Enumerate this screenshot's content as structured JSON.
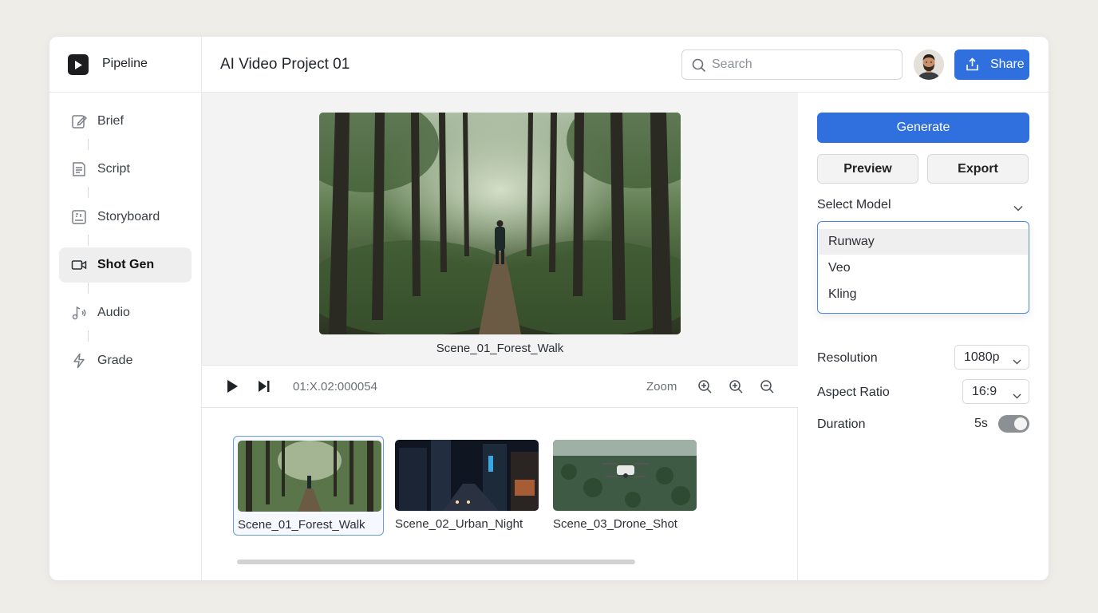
{
  "brand": {
    "name": "Pipeline",
    "logo_icon": "play-icon"
  },
  "sidebar": {
    "items": [
      {
        "label": "Brief",
        "icon": "edit-icon"
      },
      {
        "label": "Script",
        "icon": "document-icon"
      },
      {
        "label": "Storyboard",
        "icon": "storyboard-icon"
      },
      {
        "label": "Shot Gen",
        "icon": "video-camera-icon",
        "active": true
      },
      {
        "label": "Audio",
        "icon": "music-note-icon"
      },
      {
        "label": "Grade",
        "icon": "lightning-icon"
      }
    ]
  },
  "header": {
    "title": "AI Video Project 01",
    "search_placeholder": "Search",
    "share_label": "Share"
  },
  "preview": {
    "caption": "Scene_01_Forest_Walk"
  },
  "controls": {
    "timecode": "01:X.02:000054",
    "zoom_label": "Zoom"
  },
  "scenes": [
    {
      "name": "Scene_01_Forest_Walk",
      "selected": true
    },
    {
      "name": "Scene_02_Urban_Night",
      "selected": false
    },
    {
      "name": "Scene_03_Drone_Shot",
      "selected": false
    }
  ],
  "panel": {
    "generate_label": "Generate",
    "preview_label": "Preview",
    "export_label": "Export",
    "select_model_label": "Select Model",
    "model_options": [
      "Runway",
      "Veo",
      "Kling"
    ],
    "highlighted_option": "Runway",
    "resolution_label": "Resolution",
    "resolution_value": "1080p",
    "aspect_label": "Aspect Ratio",
    "aspect_value": "16:9",
    "duration_label": "Duration",
    "duration_value": "5s",
    "duration_toggle_on": true
  },
  "colors": {
    "accent": "#2f6fde",
    "background": "#efede8",
    "selected_border": "#6d9bd6"
  }
}
